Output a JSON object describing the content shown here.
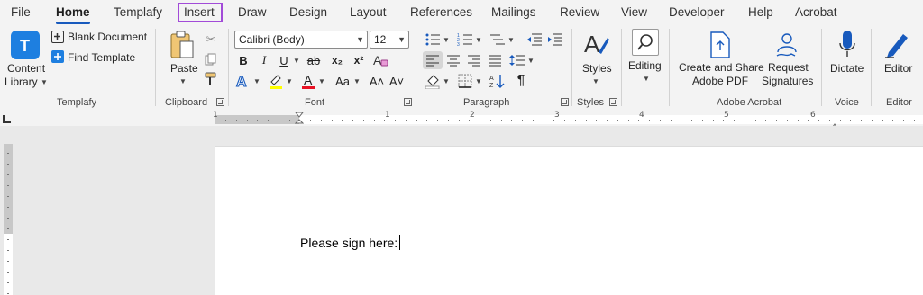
{
  "tabs": [
    "File",
    "Home",
    "Templafy",
    "Insert",
    "Draw",
    "Design",
    "Layout",
    "References",
    "Mailings",
    "Review",
    "View",
    "Developer",
    "Help",
    "Acrobat"
  ],
  "templafy": {
    "content_library": "Content",
    "content_library_2": "Library",
    "blank_document": "Blank Document",
    "find_template": "Find Template",
    "group_label": "Templafy"
  },
  "clipboard": {
    "paste": "Paste",
    "group_label": "Clipboard"
  },
  "font": {
    "font_name": "Calibri (Body)",
    "font_size": "12",
    "group_label": "Font",
    "bold": "B",
    "italic": "I",
    "underline": "U",
    "strike": "ab",
    "subscript": "x₂",
    "superscript": "x²",
    "aa": "Aa",
    "grow": "A˄",
    "shrink": "A˅"
  },
  "paragraph": {
    "group_label": "Paragraph",
    "pilcrow": "¶"
  },
  "styles": {
    "label": "Styles",
    "group_label": "Styles"
  },
  "editing": {
    "label": "Editing"
  },
  "adobe": {
    "create_share_1": "Create and Share",
    "create_share_2": "Adobe PDF",
    "request_1": "Request",
    "request_2": "Signatures",
    "group_label": "Adobe Acrobat"
  },
  "voice": {
    "dictate": "Dictate",
    "group_label": "Voice"
  },
  "editor": {
    "label": "Editor",
    "group_label": "Editor"
  },
  "ruler": {
    "numbers": [
      "1",
      "1",
      "2",
      "3",
      "4",
      "5",
      "6"
    ]
  },
  "document": {
    "text": "Please sign here:"
  },
  "colors": {
    "accent": "#185abd",
    "highlight": "#a24bd8",
    "font_color": "#e81123",
    "highlight_color": "#ffff00"
  }
}
